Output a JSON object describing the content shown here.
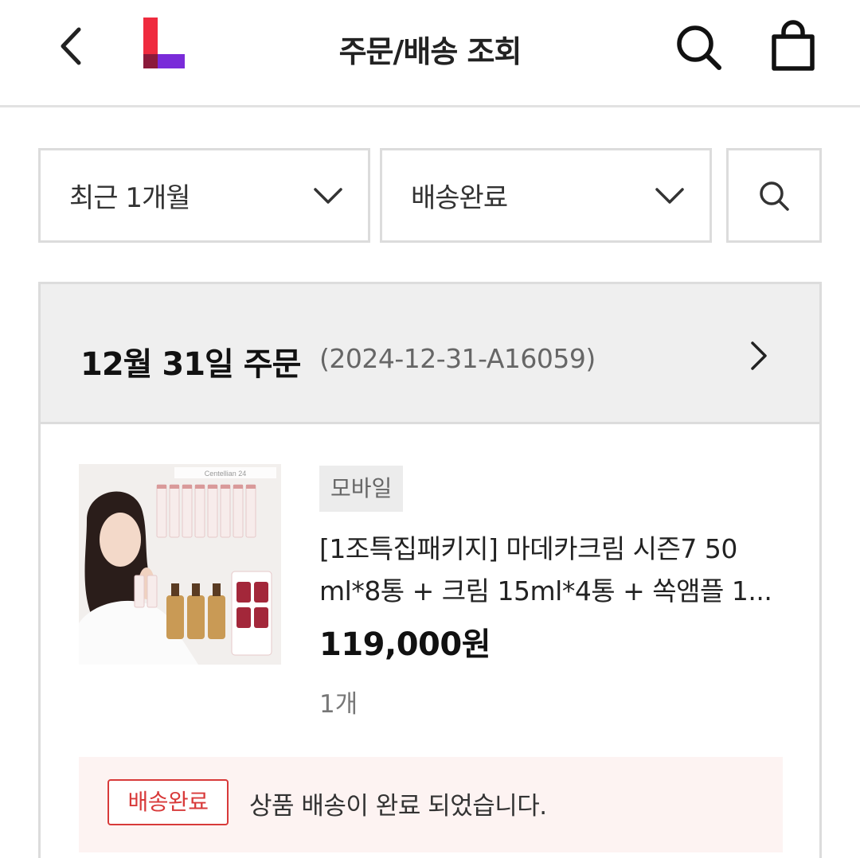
{
  "header": {
    "title": "주문/배송 조회",
    "icons": {
      "back": "chevron-left-icon",
      "logo": "l-logo",
      "search": "search-icon",
      "cart": "shopping-bag-icon"
    },
    "logo_colors": {
      "red": "#ef2b3e",
      "purple": "#7a2bd9"
    }
  },
  "filters": {
    "period": "최근 1개월",
    "status": "배송완료",
    "search_icon": "search-icon"
  },
  "order": {
    "date_label": "12월 31일 주문",
    "order_number": "(2024-12-31-A16059)",
    "item": {
      "channel_tag": "모바일",
      "name": "[1조특집패키지] 마데카크림 시즌7 50 ml*8통 + 크림 15ml*4통 + 쏙앰플 1...",
      "price": "119,000원",
      "quantity": "1개",
      "image_brand_text": "Centellian 24"
    },
    "status_badge": "배송완료",
    "status_message": "상품 배송이 완료 되었습니다.",
    "status_color": "#d83a3a"
  }
}
